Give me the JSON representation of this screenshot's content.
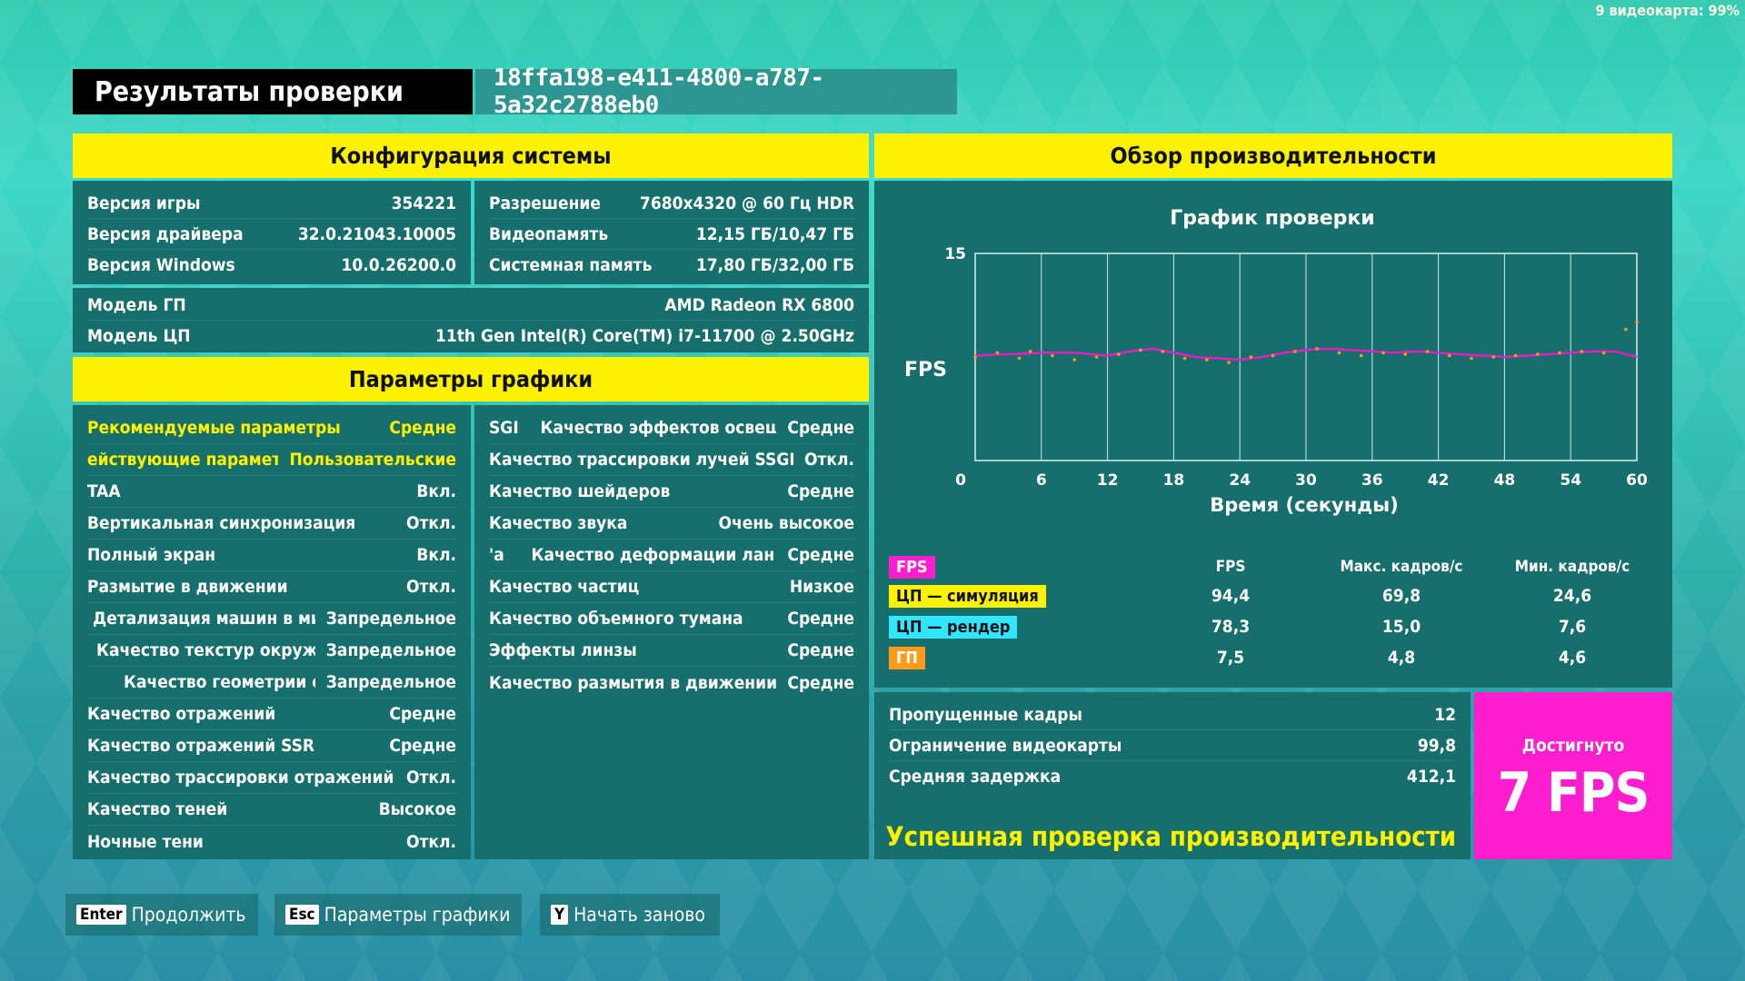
{
  "corner_gpu": "9 видеокарта: 99%",
  "header": {
    "title": "Результаты проверки",
    "session_id": "18ffa198-e411-4800-a787-5a32c2788eb0"
  },
  "system_config": {
    "heading": "Конфигурация системы",
    "left": [
      {
        "k": "Версия игры",
        "v": "354221"
      },
      {
        "k": "Версия драйвера",
        "v": "32.0.21043.10005"
      },
      {
        "k": "Версия Windows",
        "v": "10.0.26200.0"
      }
    ],
    "right": [
      {
        "k": "Разрешение",
        "v": "7680x4320 @ 60 Гц HDR"
      },
      {
        "k": "Видеопамять",
        "v": "12,15 ГБ/10,47 ГБ"
      },
      {
        "k": "Системная память",
        "v": "17,80 ГБ/32,00 ГБ"
      }
    ],
    "gpu": {
      "k": "Модель ГП",
      "v": "AMD Radeon RX 6800"
    },
    "cpu": {
      "k": "Модель ЦП",
      "v": "11th Gen Intel(R) Core(TM) i7-11700 @ 2.50GHz"
    }
  },
  "graphics": {
    "heading": "Параметры графики",
    "left": [
      {
        "k": "Рекомендуемые параметры",
        "v": "Средне"
      },
      {
        "k": "ействующие параметр",
        "v": "Пользовательские"
      },
      {
        "k": "TAA",
        "v": "Вкл."
      },
      {
        "k": "Вертикальная синхронизация",
        "v": "Откл."
      },
      {
        "k": "Полный экран",
        "v": "Вкл."
      },
      {
        "k": "Размытие в движении",
        "v": "Откл."
      },
      {
        "k": "Детализация машин в ми",
        "v": "Запредельное"
      },
      {
        "k": "Качество текстур окружен",
        "v": "Запредельное"
      },
      {
        "k": "Качество геометрии о",
        "v": "Запредельное"
      },
      {
        "k": "Качество отражений",
        "v": "Средне"
      },
      {
        "k": "Качество отражений SSR",
        "v": "Средне"
      },
      {
        "k": "Качество трассировки отражений",
        "v": "Откл."
      },
      {
        "k": "Качество теней",
        "v": "Высокое"
      },
      {
        "k": "Ночные тени",
        "v": "Откл."
      }
    ],
    "right": [
      {
        "k": "SGI    Качество эффектов освещ",
        "v": "Средне"
      },
      {
        "k": "Качество трассировки лучей SSGI",
        "v": "Откл."
      },
      {
        "k": "Качество шейдеров",
        "v": "Средне"
      },
      {
        "k": "Качество звука",
        "v": "Очень высокое"
      },
      {
        "k": "'а     Качество деформации лан",
        "v": "Средне"
      },
      {
        "k": "Качество частиц",
        "v": "Низкое"
      },
      {
        "k": "Качество объемного тумана",
        "v": "Средне"
      },
      {
        "k": "Эффекты линзы",
        "v": "Средне"
      },
      {
        "k": "Качество размытия в движении",
        "v": "Средне"
      }
    ]
  },
  "performance": {
    "heading": "Обзор производительности",
    "legend_header": [
      "FPS",
      "Макс. кадров/с",
      "Мин. кадров/с"
    ],
    "legend": [
      {
        "label": "FPS",
        "color": "#ff1ecd",
        "fps": "",
        "max": "",
        "min": ""
      },
      {
        "label": "ЦП — симуляция",
        "color": "#fff200",
        "fps": "94,4",
        "max": "69,8",
        "min": "24,6"
      },
      {
        "label": "ЦП — рендер",
        "color": "#33e6ff",
        "fps": "78,3",
        "max": "15,0",
        "min": "7,6"
      },
      {
        "label": "ГП",
        "color": "#ff9a1a",
        "fps": "7,5",
        "max": "4,8",
        "min": "4,6"
      }
    ],
    "stats": [
      {
        "k": "Пропущенные кадры",
        "v": "12"
      },
      {
        "k": "Ограничение видеокарты",
        "v": "99,8"
      },
      {
        "k": "Средняя задержка",
        "v": "412,1"
      }
    ],
    "success": "Успешная проверка производительности",
    "achieved_label": "Достигнуто",
    "achieved_value": "7 FPS"
  },
  "chart_data": {
    "type": "line",
    "title": "График проверки",
    "xlabel": "Время (секунды)",
    "ylabel": "FPS",
    "xlim": [
      0,
      60
    ],
    "ylim": [
      0,
      15
    ],
    "x_ticks": [
      "0",
      "6",
      "12",
      "18",
      "24",
      "30",
      "36",
      "42",
      "48",
      "54",
      "60"
    ],
    "y_ticks": [
      "15"
    ],
    "series": [
      {
        "name": "FPS",
        "color": "#e020c0",
        "x": [
          0,
          3,
          6,
          9,
          12,
          14,
          16,
          18,
          20,
          22,
          24,
          26,
          28,
          30,
          32,
          34,
          36,
          38,
          40,
          42,
          44,
          46,
          48,
          50,
          52,
          54,
          56,
          58,
          60
        ],
        "y": [
          7.6,
          7.7,
          7.8,
          7.8,
          7.6,
          7.9,
          8.1,
          7.8,
          7.5,
          7.4,
          7.3,
          7.5,
          7.8,
          8.0,
          8.1,
          8.0,
          7.9,
          7.8,
          7.9,
          7.8,
          7.7,
          7.6,
          7.5,
          7.6,
          7.7,
          7.8,
          7.9,
          7.9,
          7.5
        ]
      },
      {
        "name": "ГП",
        "color": "#ff9a1a",
        "x": [
          0,
          2,
          4,
          5,
          7,
          9,
          11,
          13,
          15,
          17,
          19,
          21,
          23,
          25,
          27,
          29,
          31,
          33,
          35,
          37,
          39,
          41,
          43,
          45,
          47,
          49,
          51,
          53,
          55,
          57,
          59,
          60
        ],
        "y": [
          7.5,
          7.8,
          7.4,
          7.9,
          7.6,
          7.3,
          7.5,
          7.7,
          8.0,
          7.9,
          7.4,
          7.3,
          7.1,
          7.5,
          7.6,
          7.9,
          8.1,
          7.8,
          7.6,
          7.8,
          7.7,
          7.9,
          7.6,
          7.4,
          7.5,
          7.6,
          7.7,
          7.8,
          7.9,
          7.8,
          9.5,
          10.0
        ]
      }
    ]
  },
  "buttons": [
    {
      "key": "Enter",
      "label": "Продолжить"
    },
    {
      "key": "Esc",
      "label": "Параметры графики"
    },
    {
      "key": "Y",
      "label": "Начать заново"
    }
  ]
}
